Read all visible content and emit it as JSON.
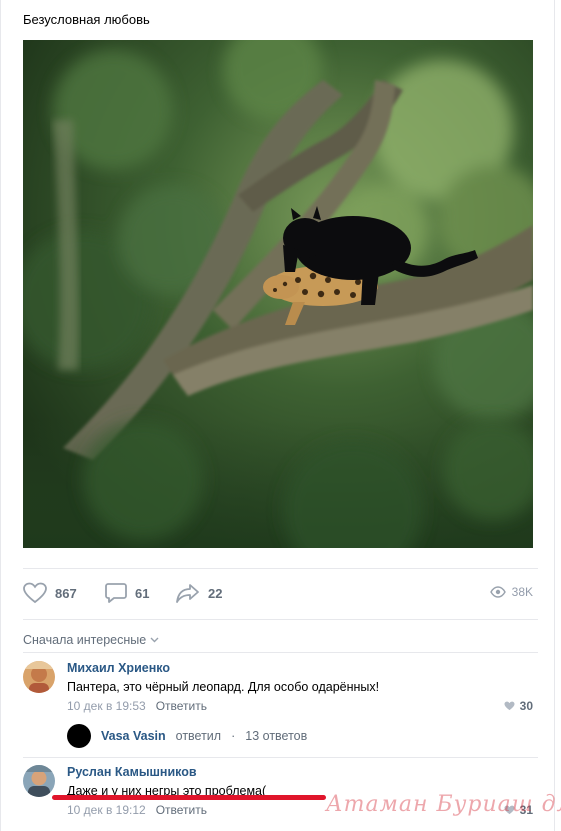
{
  "post": {
    "text": "Безусловная любовь",
    "photo_icon": "photo-black-panther-leopard"
  },
  "actions": {
    "likes": "867",
    "comments": "61",
    "shares": "22",
    "views": "38K",
    "like_icon": "heart-icon",
    "comment_icon": "comment-icon",
    "share_icon": "share-icon",
    "views_icon": "eye-icon"
  },
  "comments_sort": {
    "label": "Сначала интересные",
    "icon": "chevron-down-icon"
  },
  "comments": [
    {
      "author": "Михаил Хриенко",
      "text": "Пантера, это чёрный леопард. Для особо одарённых!",
      "date": "10 дек в 19:53",
      "reply_label": "Ответить",
      "likes": "30"
    },
    {
      "author": "Руслан Камышников",
      "text": "Даже и у них негры это проблема(",
      "date": "10 дек в 19:12",
      "reply_label": "Ответить",
      "likes": "31"
    }
  ],
  "thread": {
    "author": "Vasa Vasin",
    "action": "ответил",
    "separator": "·",
    "count": "13 ответов"
  },
  "watermark": "Атаман Буриаш для ЯП",
  "colors": {
    "link": "#2a5885",
    "muted": "#626d7a",
    "light": "#939cab",
    "divider": "#e7e8ec",
    "underline": "#e0152b"
  }
}
